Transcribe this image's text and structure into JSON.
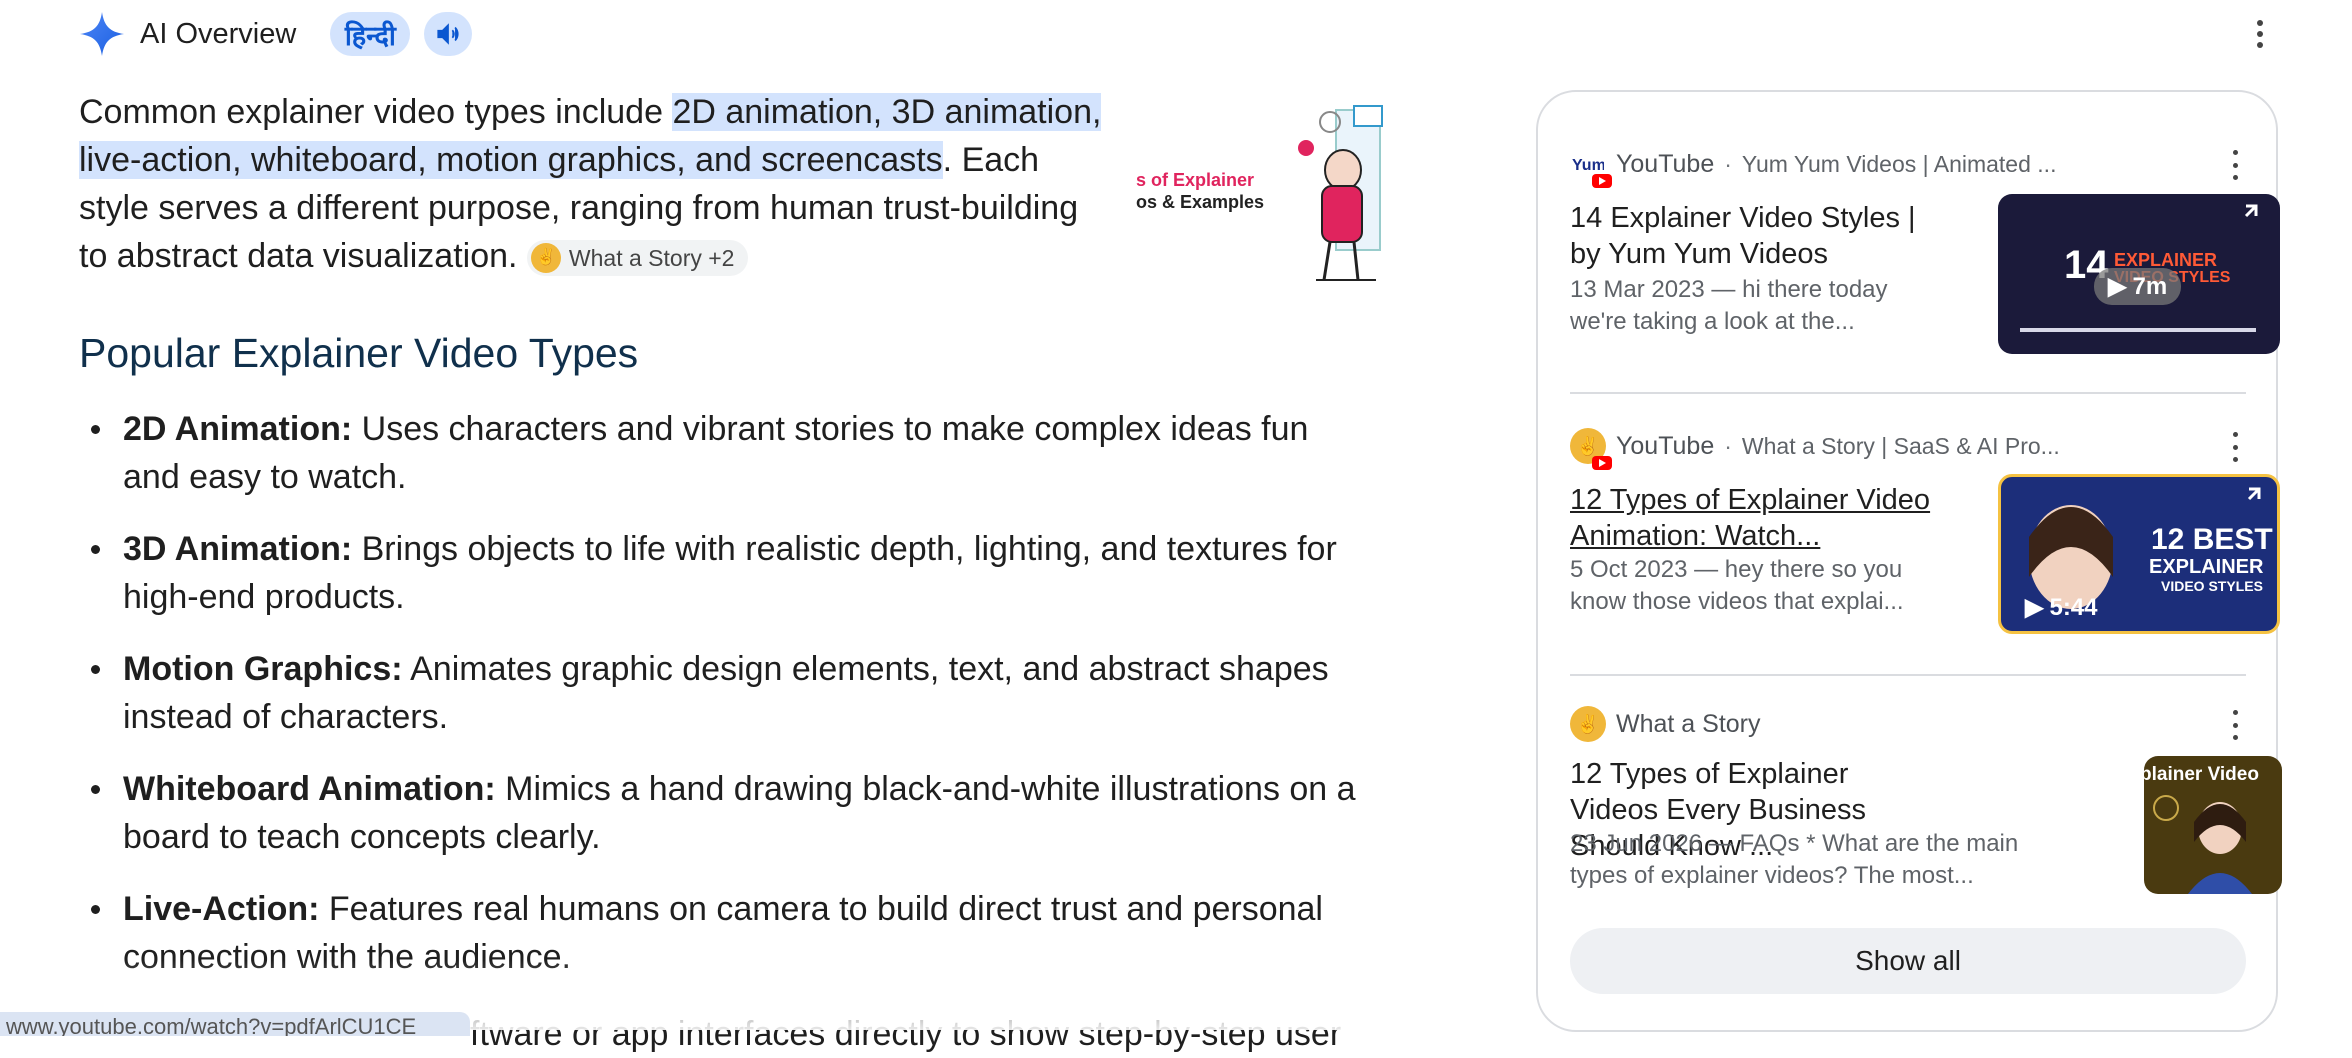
{
  "header": {
    "title": "AI Overview",
    "lang_button": "हिन्दी",
    "colors": {
      "accent": "#0b57d0",
      "pill_bg": "#d3e3fd"
    }
  },
  "intro": {
    "text_before": "Common explainer video types include ",
    "highlight": "2D animation, 3D animation, live-action, whiteboard, motion graphics, and screencasts",
    "text_after": ". Each style serves a different purpose, ranging from human trust-building to abstract data visualization.",
    "source_chip": "What a Story +2",
    "image_text_line1": "s of Explainer",
    "image_text_line2": "os & Examples"
  },
  "section": {
    "heading": "Popular Explainer Video Types",
    "items": [
      {
        "term": "2D Animation:",
        "desc": " Uses characters and vibrant stories to make complex ideas fun and easy to watch."
      },
      {
        "term": "3D Animation:",
        "desc": " Brings objects to life with realistic depth, lighting, and textures for high-end products."
      },
      {
        "term": "Motion Graphics:",
        "desc": " Animates graphic design elements, text, and abstract shapes instead of characters."
      },
      {
        "term": "Whiteboard Animation:",
        "desc": " Mimics a hand drawing black-and-white illustrations on a board to teach concepts clearly."
      },
      {
        "term": "Live-Action:",
        "desc": " Features real humans on camera to build direct trust and personal connection with the audience."
      }
    ],
    "cutoff_text": "ftware or app interfaces directly to show step-by-step user",
    "status_url": "www.youtube.com/watch?v=pdfArlCU1CE"
  },
  "sources": {
    "cards": [
      {
        "site": "YouTube",
        "channel": "Yum Yum Videos | Animated ...",
        "title": "14 Explainer Video Styles | by Yum Yum Videos",
        "snippet": "13 Mar 2023 — hi there today we're taking a look at the...",
        "duration": "7m",
        "thumb_text_num": "14",
        "thumb_text_1": "EXPLAINER",
        "thumb_text_2": "VIDEO STYLES"
      },
      {
        "site": "YouTube",
        "channel": "What a Story | SaaS & AI Pro...",
        "title": "12 Types of Explainer Video Animation: Watch...",
        "snippet": "5 Oct 2023 — hey there so you know those videos that explai...",
        "duration": "5:44",
        "thumb_text_1": "12 BEST",
        "thumb_text_2": "EXPLAINER",
        "thumb_text_3": "VIDEO STYLES"
      },
      {
        "site": "What a Story",
        "title": "12 Types of Explainer Videos Every Business Should Know ...",
        "snippet": "23 Jun 2026 — FAQs * What are the main types of explainer videos? The most...",
        "thumb_text_1": "plainer Video"
      }
    ],
    "show_all": "Show all"
  }
}
